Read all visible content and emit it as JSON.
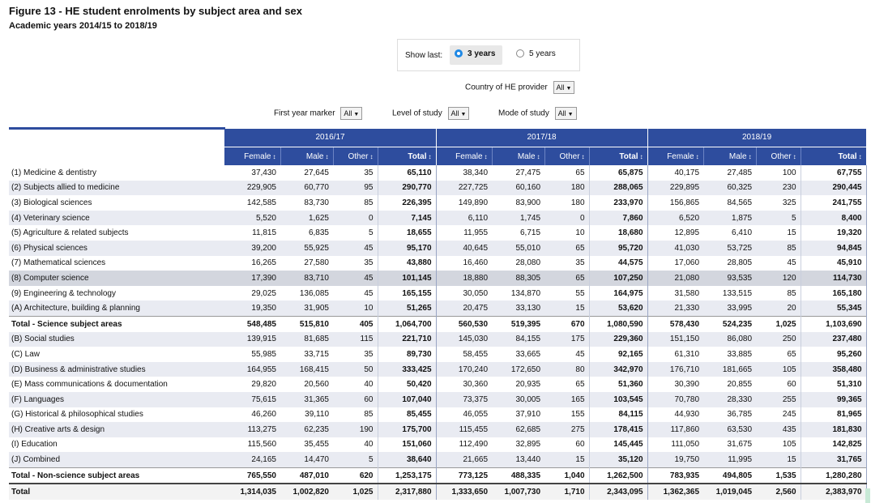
{
  "header": {
    "title": "Figure 13 - HE student enrolments by subject area and sex",
    "subtitle": "Academic years 2014/15 to 2018/19"
  },
  "show_last": {
    "label": "Show last:",
    "options": [
      "3 years",
      "5 years"
    ],
    "selected": "3 years"
  },
  "filters": {
    "country": {
      "label": "Country of HE provider",
      "value": "All"
    },
    "first_year": {
      "label": "First year marker",
      "value": "All"
    },
    "level": {
      "label": "Level of study",
      "value": "All"
    },
    "mode": {
      "label": "Mode of study",
      "value": "All"
    }
  },
  "table": {
    "years": [
      "2016/17",
      "2017/18",
      "2018/19"
    ],
    "columns": [
      "Female",
      "Male",
      "Other",
      "Total"
    ],
    "rows": [
      {
        "label": "(1) Medicine & dentistry",
        "values": [
          "37,430",
          "27,645",
          "35",
          "65,110",
          "38,340",
          "27,475",
          "65",
          "65,875",
          "40,175",
          "27,485",
          "100",
          "67,755"
        ]
      },
      {
        "label": "(2) Subjects allied to medicine",
        "values": [
          "229,905",
          "60,770",
          "95",
          "290,770",
          "227,725",
          "60,160",
          "180",
          "288,065",
          "229,895",
          "60,325",
          "230",
          "290,445"
        ]
      },
      {
        "label": "(3) Biological sciences",
        "values": [
          "142,585",
          "83,730",
          "85",
          "226,395",
          "149,890",
          "83,900",
          "180",
          "233,970",
          "156,865",
          "84,565",
          "325",
          "241,755"
        ]
      },
      {
        "label": "(4) Veterinary science",
        "values": [
          "5,520",
          "1,625",
          "0",
          "7,145",
          "6,110",
          "1,745",
          "0",
          "7,860",
          "6,520",
          "1,875",
          "5",
          "8,400"
        ]
      },
      {
        "label": "(5) Agriculture & related subjects",
        "values": [
          "11,815",
          "6,835",
          "5",
          "18,655",
          "11,955",
          "6,715",
          "10",
          "18,680",
          "12,895",
          "6,410",
          "15",
          "19,320"
        ]
      },
      {
        "label": "(6) Physical sciences",
        "values": [
          "39,200",
          "55,925",
          "45",
          "95,170",
          "40,645",
          "55,010",
          "65",
          "95,720",
          "41,030",
          "53,725",
          "85",
          "94,845"
        ]
      },
      {
        "label": "(7) Mathematical sciences",
        "values": [
          "16,265",
          "27,580",
          "35",
          "43,880",
          "16,460",
          "28,080",
          "35",
          "44,575",
          "17,060",
          "28,805",
          "45",
          "45,910"
        ]
      },
      {
        "label": "(8) Computer science",
        "values": [
          "17,390",
          "83,710",
          "45",
          "101,145",
          "18,880",
          "88,305",
          "65",
          "107,250",
          "21,080",
          "93,535",
          "120",
          "114,730"
        ]
      },
      {
        "label": "(9) Engineering & technology",
        "values": [
          "29,025",
          "136,085",
          "45",
          "165,155",
          "30,050",
          "134,870",
          "55",
          "164,975",
          "31,580",
          "133,515",
          "85",
          "165,180"
        ]
      },
      {
        "label": "(A) Architecture, building & planning",
        "values": [
          "19,350",
          "31,905",
          "10",
          "51,265",
          "20,475",
          "33,130",
          "15",
          "53,620",
          "21,330",
          "33,995",
          "20",
          "55,345"
        ]
      },
      {
        "label": "Total - Science subject areas",
        "values": [
          "548,485",
          "515,810",
          "405",
          "1,064,700",
          "560,530",
          "519,395",
          "670",
          "1,080,590",
          "578,430",
          "524,235",
          "1,025",
          "1,103,690"
        ]
      },
      {
        "label": "(B) Social studies",
        "values": [
          "139,915",
          "81,685",
          "115",
          "221,710",
          "145,030",
          "84,155",
          "175",
          "229,360",
          "151,150",
          "86,080",
          "250",
          "237,480"
        ]
      },
      {
        "label": "(C) Law",
        "values": [
          "55,985",
          "33,715",
          "35",
          "89,730",
          "58,455",
          "33,665",
          "45",
          "92,165",
          "61,310",
          "33,885",
          "65",
          "95,260"
        ]
      },
      {
        "label": "(D) Business & administrative studies",
        "values": [
          "164,955",
          "168,415",
          "50",
          "333,425",
          "170,240",
          "172,650",
          "80",
          "342,970",
          "176,710",
          "181,665",
          "105",
          "358,480"
        ]
      },
      {
        "label": "(E) Mass communications & documentation",
        "values": [
          "29,820",
          "20,560",
          "40",
          "50,420",
          "30,360",
          "20,935",
          "65",
          "51,360",
          "30,390",
          "20,855",
          "60",
          "51,310"
        ]
      },
      {
        "label": "(F) Languages",
        "values": [
          "75,615",
          "31,365",
          "60",
          "107,040",
          "73,375",
          "30,005",
          "165",
          "103,545",
          "70,780",
          "28,330",
          "255",
          "99,365"
        ]
      },
      {
        "label": "(G) Historical & philosophical studies",
        "values": [
          "46,260",
          "39,110",
          "85",
          "85,455",
          "46,055",
          "37,910",
          "155",
          "84,115",
          "44,930",
          "36,785",
          "245",
          "81,965"
        ]
      },
      {
        "label": "(H) Creative arts & design",
        "values": [
          "113,275",
          "62,235",
          "190",
          "175,700",
          "115,455",
          "62,685",
          "275",
          "178,415",
          "117,860",
          "63,530",
          "435",
          "181,830"
        ]
      },
      {
        "label": "(I) Education",
        "values": [
          "115,560",
          "35,455",
          "40",
          "151,060",
          "112,490",
          "32,895",
          "60",
          "145,445",
          "111,050",
          "31,675",
          "105",
          "142,825"
        ]
      },
      {
        "label": "(J) Combined",
        "values": [
          "24,165",
          "14,470",
          "5",
          "38,640",
          "21,665",
          "13,440",
          "15",
          "35,120",
          "19,750",
          "11,995",
          "15",
          "31,765"
        ]
      },
      {
        "label": "Total - Non-science subject areas",
        "values": [
          "765,550",
          "487,010",
          "620",
          "1,253,175",
          "773,125",
          "488,335",
          "1,040",
          "1,262,500",
          "783,935",
          "494,805",
          "1,535",
          "1,280,280"
        ]
      },
      {
        "label": "Total",
        "values": [
          "1,314,035",
          "1,002,820",
          "1,025",
          "2,317,880",
          "1,333,650",
          "1,007,730",
          "1,710",
          "2,343,095",
          "1,362,365",
          "1,019,045",
          "2,560",
          "2,383,970"
        ]
      }
    ]
  }
}
